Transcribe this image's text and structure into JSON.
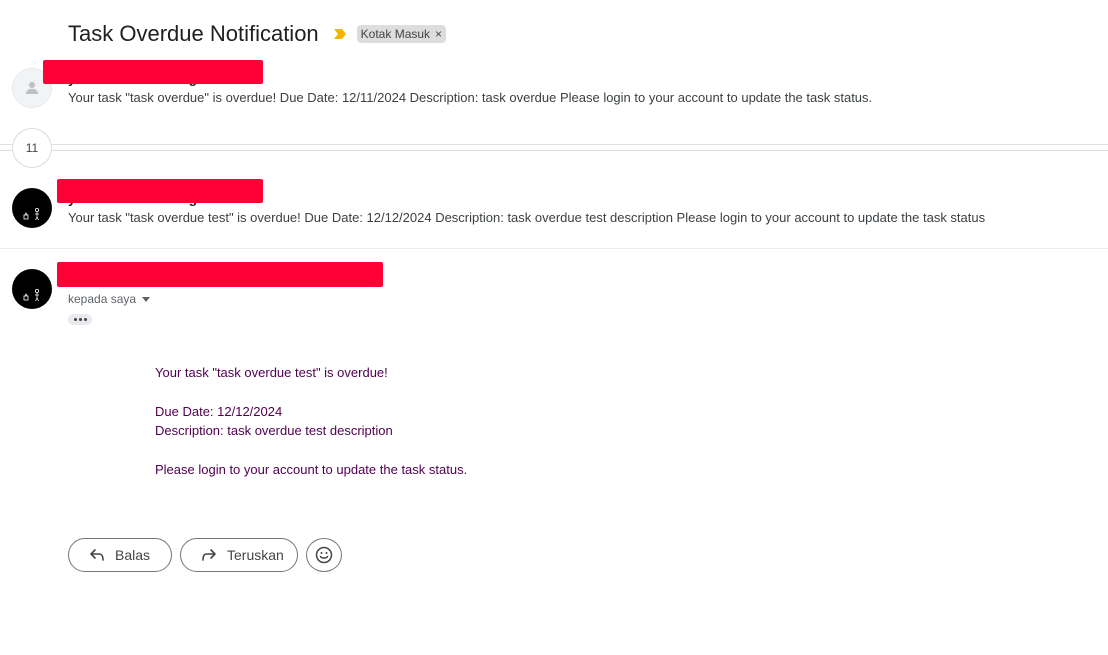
{
  "subject": "Task Overdue Notification",
  "label": "Kotak Masuk",
  "label_close": "×",
  "thread": {
    "hidden_count": "11",
    "messages": [
      {
        "sender_visible": "",
        "snippet": "Your task \"task overdue\" is overdue! Due Date: 12/11/2024 Description: task overdue Please login to your account to update the task status."
      },
      {
        "sender_visible": "",
        "snippet": "Your task \"task overdue test\" is overdue! Due Date: 12/12/2024 Description: task overdue test description Please login to your account to update the task status"
      }
    ],
    "open_message": {
      "to_label": "kepada saya",
      "body": {
        "line1": "Your task \"task overdue test\" is overdue!",
        "line2": "Due Date: 12/12/2024",
        "line3": "Description: task overdue test description",
        "line4": "Please login to your account to update the task status."
      }
    }
  },
  "actions": {
    "reply": "Balas",
    "forward": "Teruskan"
  },
  "colors": {
    "redaction": "#ff0037",
    "body_text": "#500050",
    "importance": "#f4b400"
  }
}
